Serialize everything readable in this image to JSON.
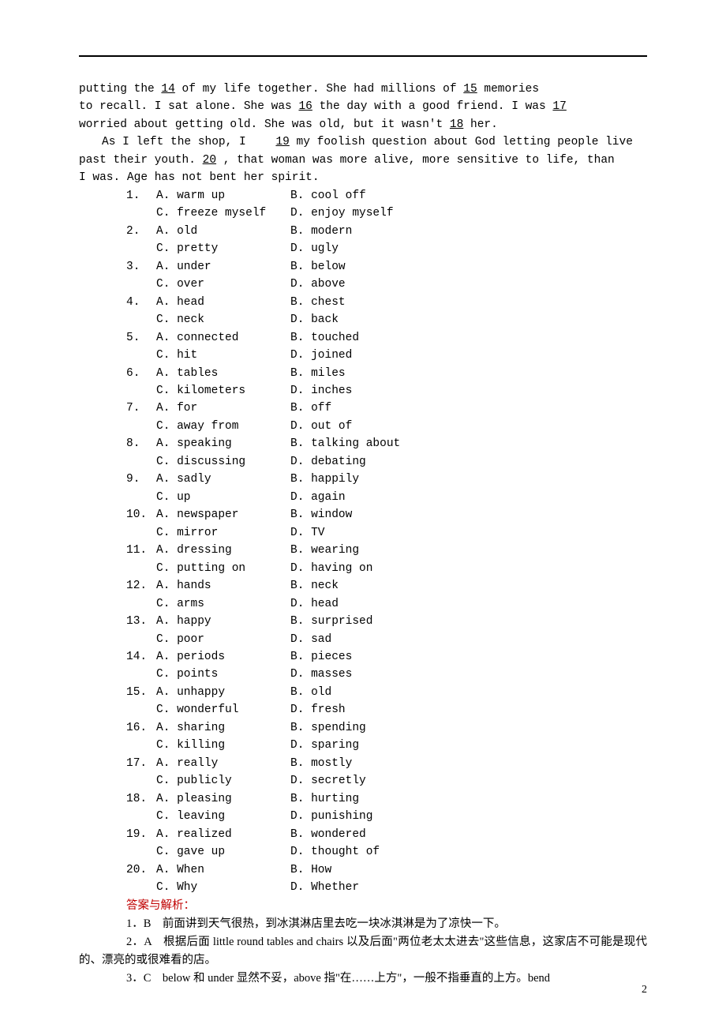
{
  "passage": {
    "line1_a": "putting the",
    "blank14": "  14  ",
    "line1_b": " of my life together. She had millions of ",
    "blank15": "  15  ",
    "line1_c": " memories",
    "line2_a": "to recall. I sat alone. She was ",
    "blank16": "  16  ",
    "line2_b": " the day with a good friend. I was ",
    "blank17": "  17  ",
    "line3_a": "worried about getting old. She was old, but it wasn't ",
    "blank18": "  18  ",
    "line3_b": " her.",
    "line4_a": "As I left the shop, I ",
    "blank19": "  19  ",
    "line4_b": " my foolish question about God letting people live",
    "line5_a": "past their youth. ",
    "blank20": "  20  ",
    "line5_b": " , that woman was more alive, more sensitive to life, than",
    "line6": "I was. Age has not bent her spirit."
  },
  "questions": [
    {
      "num": "1.",
      "A": "A. warm up",
      "B": "B. cool off",
      "C": "C. freeze myself",
      "D": "D. enjoy myself"
    },
    {
      "num": "2.",
      "A": "A. old",
      "B": "B. modern",
      "C": "C. pretty",
      "D": "D. ugly"
    },
    {
      "num": "3.",
      "A": "A. under",
      "B": "B. below",
      "C": "C. over",
      "D": "D. above"
    },
    {
      "num": "4.",
      "A": "A. head",
      "B": "B. chest",
      "C": "C. neck",
      "D": "D. back"
    },
    {
      "num": "5.",
      "A": "A. connected",
      "B": "B. touched",
      "C": "C. hit",
      "D": "D. joined"
    },
    {
      "num": "6.",
      "A": "A. tables",
      "B": "B. miles",
      "C": "C. kilometers",
      "D": "D. inches"
    },
    {
      "num": "7.",
      "A": "A. for",
      "B": "B. off",
      "C": "C. away from",
      "D": "D. out of"
    },
    {
      "num": "8.",
      "A": "A. speaking",
      "B": "B. talking about",
      "C": "C. discussing",
      "D": "D. debating"
    },
    {
      "num": "9.",
      "A": "A. sadly",
      "B": "B. happily",
      "C": "C. up",
      "D": "D. again"
    },
    {
      "num": "10.",
      "A": "A. newspaper",
      "B": "B. window",
      "C": "C. mirror",
      "D": "D. TV"
    },
    {
      "num": "11.",
      "A": "A. dressing",
      "B": "B. wearing",
      "C": "C. putting on",
      "D": "D. having on"
    },
    {
      "num": "12.",
      "A": "A. hands",
      "B": "B. neck",
      "C": "C. arms",
      "D": "D. head"
    },
    {
      "num": "13.",
      "A": "A. happy",
      "B": "B. surprised",
      "C": "C. poor",
      "D": "D. sad"
    },
    {
      "num": "14.",
      "A": "A. periods",
      "B": "B. pieces",
      "C": "C. points",
      "D": "D. masses"
    },
    {
      "num": "15.",
      "A": "A. unhappy",
      "B": "B. old",
      "C": "C. wonderful",
      "D": "D. fresh"
    },
    {
      "num": "16.",
      "A": "A. sharing",
      "B": "B. spending",
      "C": "C. killing",
      "D": "D. sparing"
    },
    {
      "num": "17.",
      "A": "A. really",
      "B": "B. mostly",
      "C": "C. publicly",
      "D": "D. secretly"
    },
    {
      "num": "18.",
      "A": "A. pleasing",
      "B": "B. hurting",
      "C": "C. leaving",
      "D": "D. punishing"
    },
    {
      "num": "19.",
      "A": "A. realized",
      "B": "B. wondered",
      "C": "C. gave up",
      "D": "D. thought of"
    },
    {
      "num": "20.",
      "A": "A. When",
      "B": "B. How",
      "C": "C. Why",
      "D": "D. Whether"
    }
  ],
  "answers": {
    "header": "答案与解析：",
    "a1": "1．B　前面讲到天气很热，到冰淇淋店里去吃一块冰淇淋是为了凉快一下。",
    "a2": "2．A　根据后面 little round tables and chairs 以及后面\"两位老太太进去\"这些信息，这家店不可能是现代的、漂亮的或很难看的店。",
    "a3": "3．C　below 和 under 显然不妥，above 指\"在……上方\"，一般不指垂直的上方。bend"
  },
  "pageNumber": "2"
}
